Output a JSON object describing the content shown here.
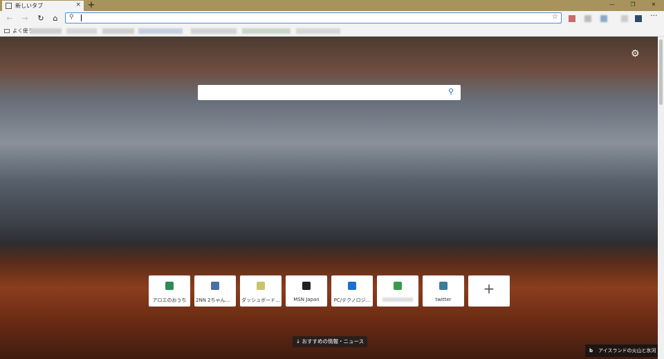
{
  "titlebar": {
    "tab_label": "新しいタブ",
    "tab_close": "×",
    "new_tab": "+",
    "minimize": "—",
    "maximize": "❐",
    "close": "✕"
  },
  "navbar": {
    "back": "←",
    "forward": "→",
    "refresh": "↻",
    "home": "⌂",
    "address_value": "",
    "address_placeholder": "",
    "more": "···"
  },
  "favorites": {
    "folder_label": "よく使う"
  },
  "main": {
    "settings_icon": "⚙",
    "search_placeholder": "",
    "tiles": [
      {
        "label": "アロエのおうち",
        "color": "#2e8b57"
      },
      {
        "label": "2NN 2ちゃんね...",
        "color": "#4a6fa5"
      },
      {
        "label": "ダッシュボード...",
        "color": "#c9c36a"
      },
      {
        "label": "MSN Japan",
        "color": "#222222"
      },
      {
        "label": "PC/テクノロジ...",
        "color": "#1a6fd1"
      },
      {
        "label": "",
        "color": "#3a9a4a"
      },
      {
        "label": "twitter",
        "color": "#3b7c9a"
      }
    ],
    "add_tile": "+",
    "news_button": "↓ おすすめの情報・ニュース",
    "image_credit": "アイスランドの火山と氷河",
    "bing_logo": "b"
  }
}
